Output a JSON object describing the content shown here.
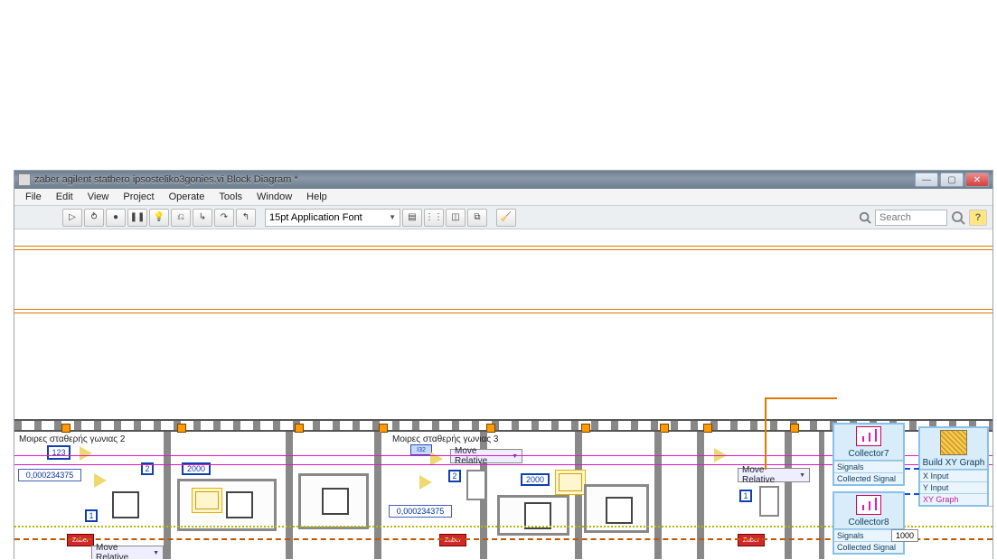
{
  "window": {
    "title": "zaber agilent stathero ipsosteliko3gonies.vi Block Diagram *"
  },
  "menu": {
    "file": "File",
    "edit": "Edit",
    "view": "View",
    "project": "Project",
    "operate": "Operate",
    "tools": "Tools",
    "window": "Window",
    "help": "Help"
  },
  "toolbar": {
    "font": "15pt Application Font",
    "search_placeholder": "Search"
  },
  "diagram": {
    "label2": "Μοιρες σταθερής γωνιας 2",
    "label3": "Μοιρες σταθερής γωνιας 3",
    "const_a": "0,000234375",
    "const_b": "0,000234375",
    "n2": "2",
    "n2b": "2",
    "n1": "1",
    "n1b": "1",
    "k2000a": "2000",
    "k2000b": "2000",
    "k1000": "1000",
    "move_rel": "Move Relative",
    "i32": "I32",
    "zaber": "Zaber",
    "i123": "123"
  },
  "panels": {
    "collector7": "Collector7",
    "collector8": "Collector8",
    "signals": "Signals",
    "collected": "Collected Signal",
    "build": "Build XY Graph",
    "xin": "X Input",
    "yin": "Y Input",
    "xygraph": "XY Graph"
  }
}
